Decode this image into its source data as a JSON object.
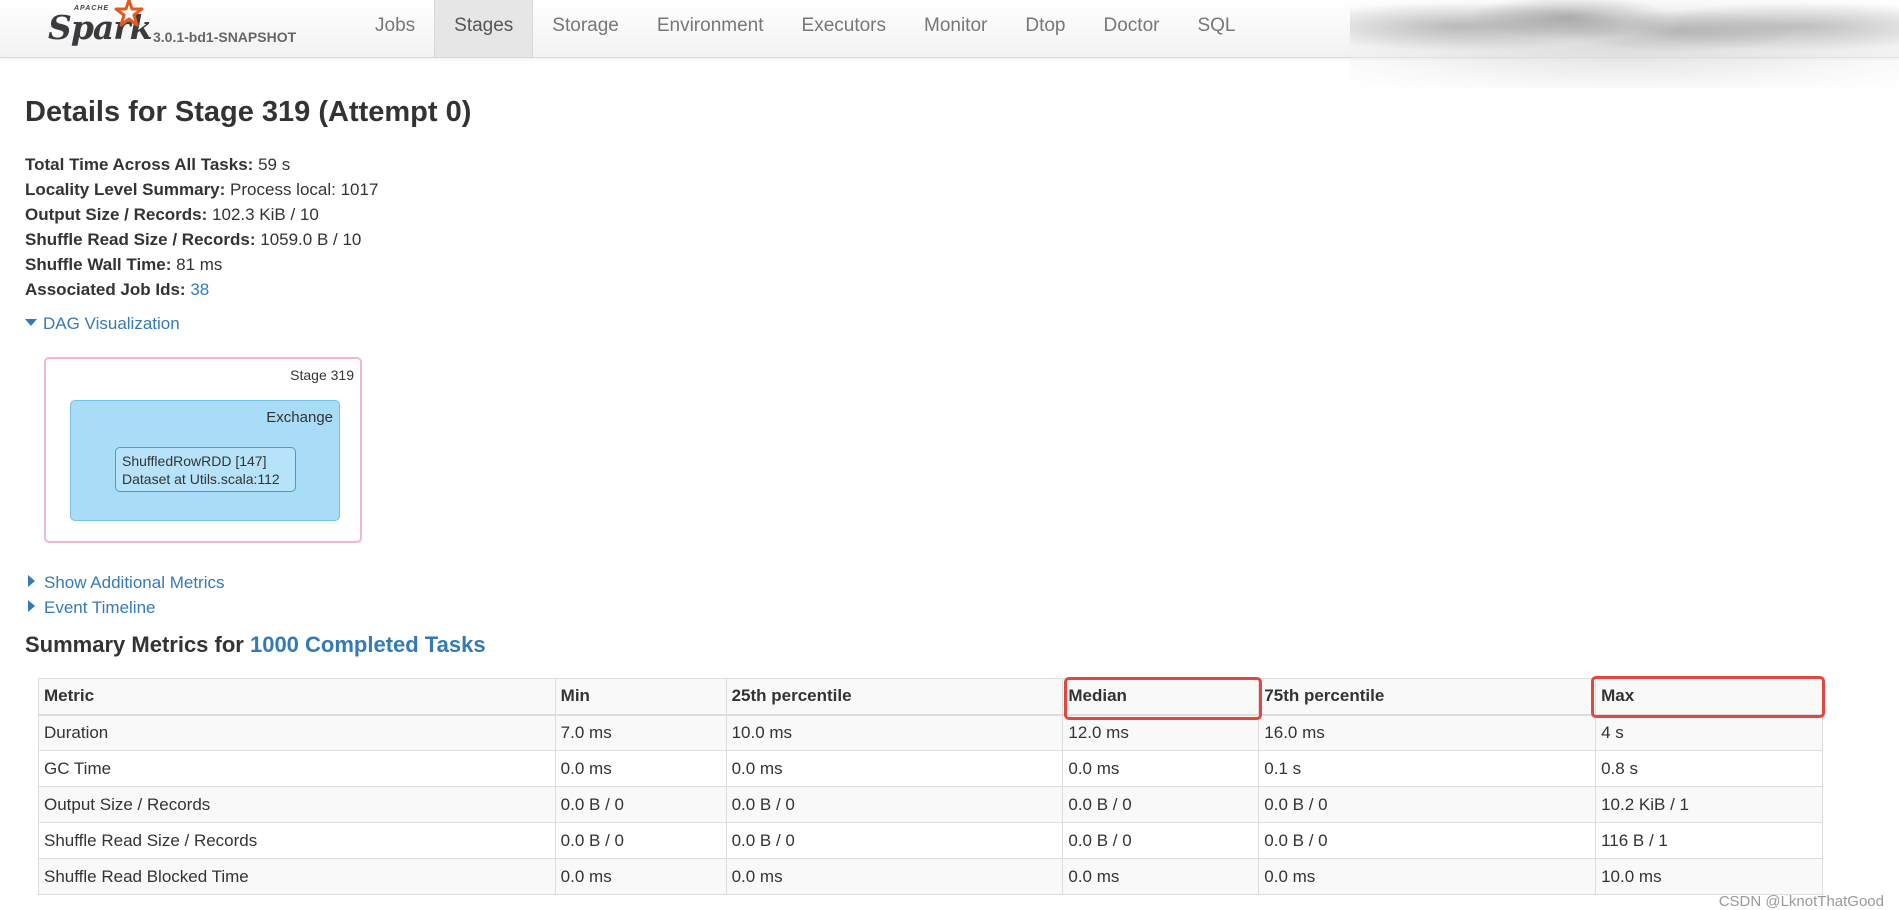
{
  "brand": {
    "apache": "APACHE",
    "name": "Spark",
    "version": "3.0.1-bd1-SNAPSHOT"
  },
  "nav": [
    {
      "label": "Jobs",
      "active": false
    },
    {
      "label": "Stages",
      "active": true
    },
    {
      "label": "Storage",
      "active": false
    },
    {
      "label": "Environment",
      "active": false
    },
    {
      "label": "Executors",
      "active": false
    },
    {
      "label": "Monitor",
      "active": false
    },
    {
      "label": "Dtop",
      "active": false
    },
    {
      "label": "Doctor",
      "active": false
    },
    {
      "label": "SQL",
      "active": false
    }
  ],
  "page_title": "Details for Stage 319 (Attempt 0)",
  "summary": {
    "total_time": {
      "label": "Total Time Across All Tasks:",
      "value": "59 s"
    },
    "locality": {
      "label": "Locality Level Summary:",
      "value": "Process local: 1017"
    },
    "output": {
      "label": "Output Size / Records:",
      "value": "102.3 KiB / 10"
    },
    "shuffle_read": {
      "label": "Shuffle Read Size / Records:",
      "value": "1059.0 B / 10"
    },
    "shuffle_wall": {
      "label": "Shuffle Wall Time:",
      "value": "81 ms"
    },
    "job_ids": {
      "label": "Associated Job Ids:",
      "value": "38"
    }
  },
  "dag": {
    "toggle_label": "DAG Visualization",
    "stage_label": "Stage 319",
    "cluster_label": "Exchange",
    "node_line1": "ShuffledRowRDD [147]",
    "node_line2": "Dataset at Utils.scala:112"
  },
  "toggles": {
    "additional_metrics": "Show Additional Metrics",
    "event_timeline": "Event Timeline"
  },
  "summary_metrics": {
    "title_prefix": "Summary Metrics for ",
    "title_link": "1000 Completed Tasks",
    "headers": [
      "Metric",
      "Min",
      "25th percentile",
      "Median",
      "75th percentile",
      "Max"
    ],
    "rows": [
      [
        "Duration",
        "7.0 ms",
        "10.0 ms",
        "12.0 ms",
        "16.0 ms",
        "4 s"
      ],
      [
        "GC Time",
        "0.0 ms",
        "0.0 ms",
        "0.0 ms",
        "0.1 s",
        "0.8 s"
      ],
      [
        "Output Size / Records",
        "0.0 B / 0",
        "0.0 B / 0",
        "0.0 B / 0",
        "0.0 B / 0",
        "10.2 KiB / 1"
      ],
      [
        "Shuffle Read Size / Records",
        "0.0 B / 0",
        "0.0 B / 0",
        "0.0 B / 0",
        "0.0 B / 0",
        "116 B / 1"
      ],
      [
        "Shuffle Read Blocked Time",
        "0.0 ms",
        "0.0 ms",
        "0.0 ms",
        "0.0 ms",
        "10.0 ms"
      ]
    ]
  },
  "watermark": "CSDN @LknotThatGood",
  "colors": {
    "link": "#337ab7",
    "highlight": "#e3463e",
    "dag_stage_border": "#f2b8c5",
    "dag_cluster_fill": "#a9dcf6"
  }
}
